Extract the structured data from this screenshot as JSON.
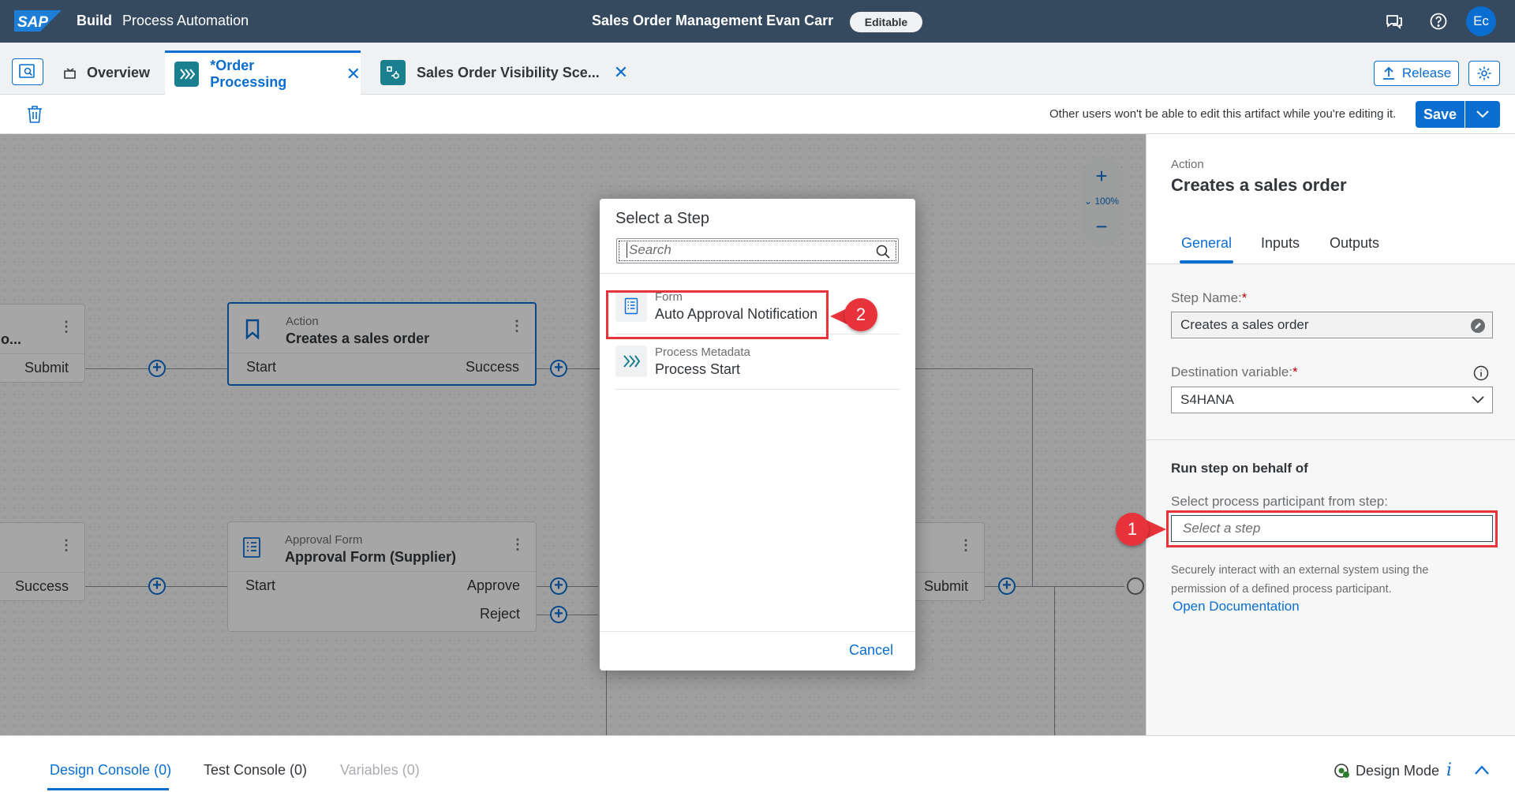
{
  "shell": {
    "logo": "SAP",
    "build": "Build",
    "product": "Process Automation",
    "title": "Sales Order Management Evan Carr",
    "badge": "Editable",
    "avatar": "Ec",
    "icons": [
      "feedback-icon",
      "help-icon"
    ]
  },
  "tabs": {
    "overview": "Overview",
    "active": "*Order Processing",
    "third": "Sales Order Visibility Sce...",
    "release": "Release"
  },
  "toolbar": {
    "message": "Other users won't be able to edit this artifact while you're editing it.",
    "save": "Save"
  },
  "canvas": {
    "node_left_top": {
      "title": "o...",
      "port_right": "Submit"
    },
    "node_action": {
      "type": "Action",
      "title": "Creates a sales order",
      "port_left": "Start",
      "port_right": "Success"
    },
    "node_left_bottom": {
      "port_right": "Success"
    },
    "node_approval": {
      "type": "Approval Form",
      "title": "Approval Form (Supplier)",
      "port_left": "Start",
      "port_approve": "Approve",
      "port_reject": "Reject"
    },
    "node_right_bottom": {
      "port_right": "Submit"
    },
    "zoom": {
      "level": "100%",
      "plus": "+",
      "minus": "−"
    }
  },
  "dialog": {
    "title": "Select a Step",
    "search_placeholder": "Search",
    "items": [
      {
        "type": "Form",
        "name": "Auto Approval Notification",
        "icon": "form-icon"
      },
      {
        "type": "Process Metadata",
        "name": "Process Start",
        "icon": "process-icon"
      }
    ],
    "cancel": "Cancel"
  },
  "panel": {
    "type": "Action",
    "title": "Creates a sales order",
    "tabs": [
      "General",
      "Inputs",
      "Outputs"
    ],
    "step_name_label": "Step Name:",
    "step_name_value": "Creates a sales order",
    "dest_label": "Destination variable:",
    "dest_value": "S4HANA",
    "run_heading": "Run step on behalf of",
    "participant_label": "Select process participant from step:",
    "participant_placeholder": "Select a step",
    "description": "Securely interact with an external system using the permission of a defined process participant.",
    "doc_link": "Open Documentation",
    "required_mark": "*"
  },
  "annotations": {
    "one": "1",
    "two": "2",
    "color": "#e9333b"
  },
  "console": {
    "tabs": [
      "Design Console (0)",
      "Test Console (0)",
      "Variables (0)"
    ],
    "mode": "Design Mode",
    "info": "i"
  }
}
